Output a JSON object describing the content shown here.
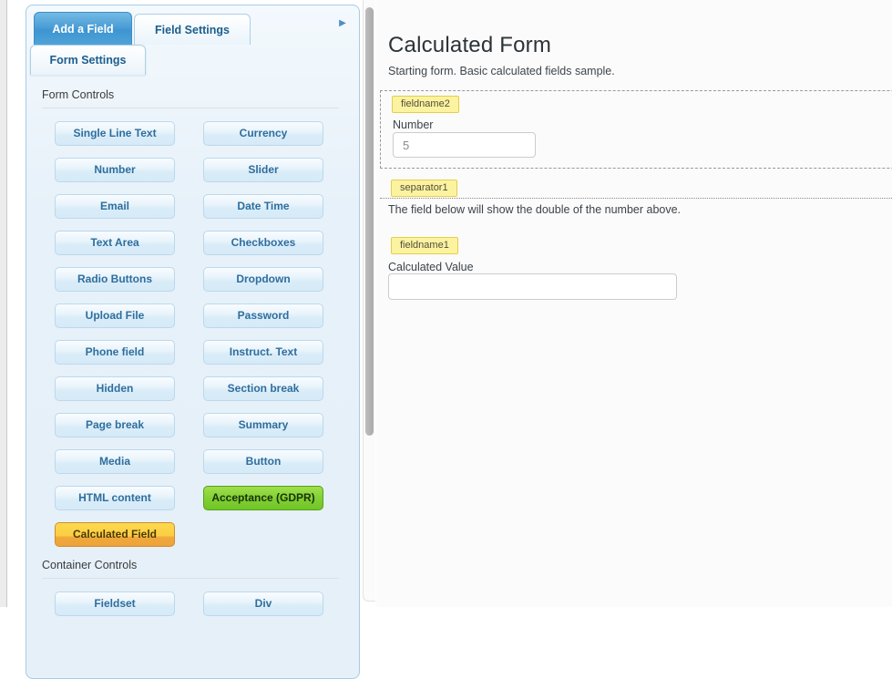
{
  "left_panel": {
    "arrow_glyph": "▶",
    "tabs": {
      "add_field": "Add a Field",
      "field_settings": "Field Settings",
      "form_settings": "Form Settings"
    },
    "form_controls": {
      "title": "Form Controls",
      "buttons": [
        "Single Line Text",
        "Currency",
        "Number",
        "Slider",
        "Email",
        "Date Time",
        "Text Area",
        "Checkboxes",
        "Radio Buttons",
        "Dropdown",
        "Upload File",
        "Password",
        "Phone field",
        "Instruct. Text",
        "Hidden",
        "Section break",
        "Page break",
        "Summary",
        "Media",
        "Button",
        "HTML content",
        "Acceptance (GDPR)",
        "Calculated Field"
      ]
    },
    "container_controls": {
      "title": "Container Controls",
      "buttons": [
        "Fieldset",
        "Div"
      ]
    }
  },
  "form_preview": {
    "title": "Calculated Form",
    "subtitle": "Starting form. Basic calculated fields sample.",
    "number_field": {
      "tag": "fieldname2",
      "label": "Number",
      "value": "5"
    },
    "separator": {
      "tag": "separator1",
      "description": "The field below will show the double of the number above."
    },
    "calculated_field": {
      "tag": "fieldname1",
      "label": "Calculated Value",
      "value": ""
    }
  },
  "colors": {
    "accent_blue": "#3d95d1",
    "button_text_blue": "#2e6e9e",
    "green_button": "#70c528",
    "orange_button": "#eda43a",
    "badge_yellow": "#fcf3a1"
  }
}
